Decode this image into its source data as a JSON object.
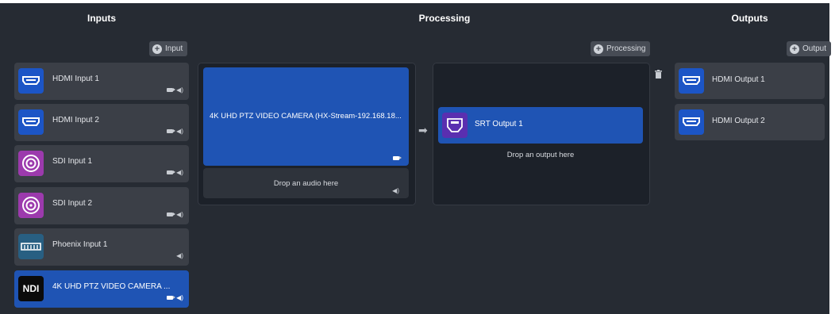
{
  "columns": {
    "inputs": "Inputs",
    "processing": "Processing",
    "outputs": "Outputs"
  },
  "buttons": {
    "add_input": "Input",
    "add_processing": "Processing",
    "add_output": "Output"
  },
  "inputs": [
    {
      "label": "HDMI Input 1",
      "icon": "hdmi-icon",
      "video": true,
      "audio": true
    },
    {
      "label": "HDMI Input 2",
      "icon": "hdmi-icon",
      "video": true,
      "audio": true
    },
    {
      "label": "SDI Input 1",
      "icon": "sdi-icon",
      "video": true,
      "audio": true
    },
    {
      "label": "SDI Input 2",
      "icon": "sdi-icon",
      "video": true,
      "audio": true
    },
    {
      "label": "Phoenix Input 1",
      "icon": "phoenix-icon",
      "video": false,
      "audio": true
    },
    {
      "label": "4K UHD PTZ VIDEO CAMERA ...",
      "icon": "ndi-icon",
      "icon_text": "NDI",
      "video": true,
      "audio": true,
      "selected": true
    }
  ],
  "processing": {
    "video_source": "4K UHD PTZ VIDEO CAMERA (HX-Stream-192.168.18...",
    "audio_drop": "Drop an audio here",
    "output": "SRT Output 1",
    "output_drop": "Drop an output here"
  },
  "outputs": [
    {
      "label": "HDMI Output 1",
      "icon": "hdmi-icon"
    },
    {
      "label": "HDMI Output 2",
      "icon": "hdmi-icon"
    }
  ],
  "colors": {
    "background": "#262b33",
    "selected": "#1f54b4",
    "card": "#3b3f47",
    "hdmi": "#1c55c6",
    "sdi": "#9c3aad"
  }
}
